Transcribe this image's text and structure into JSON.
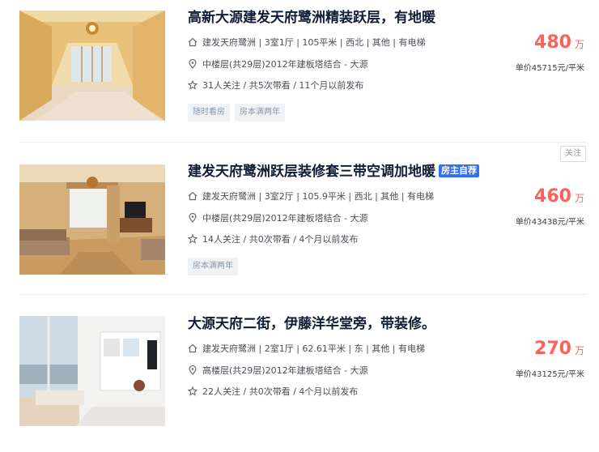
{
  "listings": [
    {
      "title": "高新大源建发天府鹭洲精装跃层，有地暖",
      "badge": "",
      "house_info": "建发天府鹭洲 | 3室1厅 | 105平米 | 西北 | 其他 | 有电梯",
      "position_info": "中楼层(共29层)2012年建板塔结合 - 大源",
      "follow_info": "31人关注 / 共5次带看 / 11个月以前发布",
      "tags": [
        "随时看房",
        "房本满两年"
      ],
      "price": "480",
      "price_unit": "万",
      "unit_price": "单价45715元/平米"
    },
    {
      "title": "建发天府鹭洲跃层装修套三带空调加地暖",
      "badge": "房主自荐",
      "house_info": "建发天府鹭洲 | 3室2厅 | 105.9平米 | 西北 | 其他 | 有电梯",
      "position_info": "中楼层(共29层)2012年建板塔结合 - 大源",
      "follow_info": "14人关注 / 共0次带看 / 4个月以前发布",
      "tags": [
        "房本满两年"
      ],
      "price": "460",
      "price_unit": "万",
      "unit_price": "单价43438元/平米",
      "follow_button": "关注"
    },
    {
      "title": "大源天府二街，伊藤洋华堂旁，带装修。",
      "badge": "",
      "house_info": "建发天府鹭洲 | 2室1厅 | 62.61平米 | 东 | 其他 | 有电梯",
      "position_info": "高楼层(共29层)2012年建板塔结合 - 大源",
      "follow_info": "22人关注 / 共0次带看 / 4个月以前发布",
      "tags": [],
      "price": "270",
      "price_unit": "万",
      "unit_price": "单价43125元/平米"
    }
  ],
  "colors": {
    "price": "#fe615a",
    "badge": "#3072f6",
    "title": "#101d37",
    "tag_text": "#849aae"
  },
  "icons": [
    "house-icon",
    "location-pin-icon",
    "star-icon"
  ]
}
